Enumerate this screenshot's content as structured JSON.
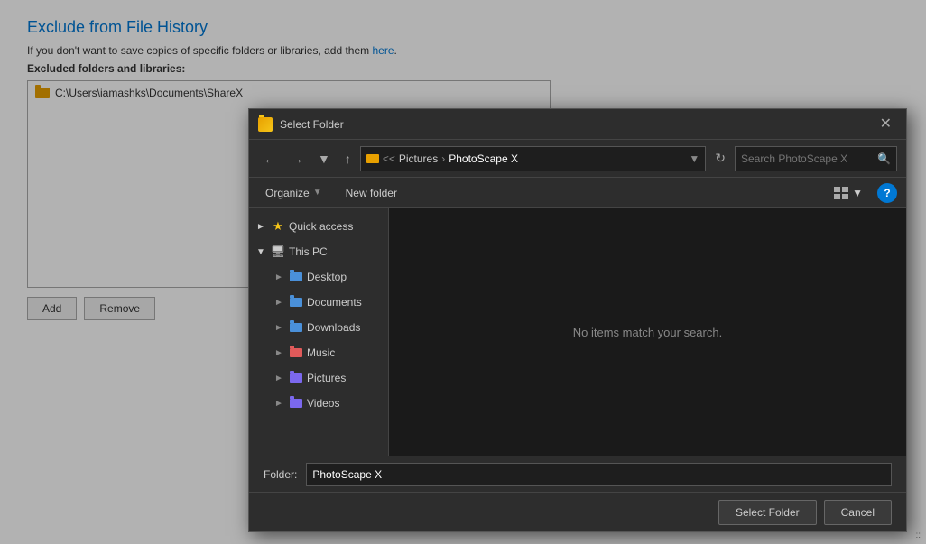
{
  "page": {
    "title": "Exclude from File History",
    "description": "If you don't want to save copies of specific folders or libraries, add them here.",
    "description_link_text": "here",
    "section_label": "Excluded folders and libraries:",
    "excluded_items": [
      {
        "path": "C:\\Users\\iamashks\\Documents\\ShareX"
      }
    ],
    "add_button": "Add",
    "remove_button": "Remove"
  },
  "dialog": {
    "title": "Select Folder",
    "nav": {
      "back_label": "Back",
      "forward_label": "Forward",
      "recent_label": "Recent locations",
      "up_label": "Up"
    },
    "breadcrumb": {
      "separator": ">>",
      "path_parts": [
        "Pictures",
        "PhotoScape X"
      ],
      "current": "PhotoScape X"
    },
    "search_placeholder": "Search PhotoScape X",
    "toolbar": {
      "organize_label": "Organize",
      "new_folder_label": "New folder",
      "view_label": "View"
    },
    "tree": {
      "items": [
        {
          "id": "quick-access",
          "label": "Quick access",
          "icon": "star",
          "expanded": true,
          "indent": 0
        },
        {
          "id": "this-pc",
          "label": "This PC",
          "icon": "monitor",
          "expanded": true,
          "indent": 0
        },
        {
          "id": "desktop",
          "label": "Desktop",
          "icon": "folder-blue",
          "expanded": false,
          "indent": 1
        },
        {
          "id": "documents",
          "label": "Documents",
          "icon": "folder-blue",
          "expanded": false,
          "indent": 1
        },
        {
          "id": "downloads",
          "label": "Downloads",
          "icon": "folder-download",
          "expanded": false,
          "indent": 1
        },
        {
          "id": "music",
          "label": "Music",
          "icon": "folder-music",
          "expanded": false,
          "indent": 1
        },
        {
          "id": "pictures",
          "label": "Pictures",
          "icon": "folder-pictures",
          "expanded": false,
          "indent": 1
        },
        {
          "id": "videos",
          "label": "Videos",
          "icon": "folder-videos",
          "expanded": false,
          "indent": 1
        }
      ]
    },
    "empty_message": "No items match your search.",
    "folder_label": "Folder:",
    "folder_value": "PhotoScape X",
    "select_button": "Select Folder",
    "cancel_button": "Cancel"
  }
}
